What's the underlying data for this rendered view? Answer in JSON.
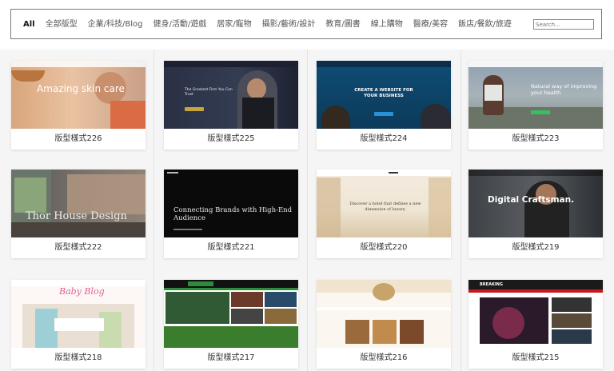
{
  "filters": [
    "All",
    "全部版型",
    "企業/科技/Blog",
    "健身/活動/遊戲",
    "居家/寵物",
    "攝影/藝術/設計",
    "教育/圖書",
    "線上購物",
    "醫療/美容",
    "飯店/餐飲/旅遊"
  ],
  "search": {
    "placeholder": "Search..."
  },
  "cards": [
    {
      "caption": "版型樣式226",
      "headline": "Amazing skin care"
    },
    {
      "caption": "版型樣式225",
      "headline": "The Greatest Firm You Can Trust"
    },
    {
      "caption": "版型樣式224",
      "headline": "CREATE A WEBSITE FOR YOUR BUSINESS"
    },
    {
      "caption": "版型樣式223",
      "headline": "Natural way of improving your health"
    },
    {
      "caption": "版型樣式222",
      "headline": "Thor House Design"
    },
    {
      "caption": "版型樣式221",
      "headline": "Connecting Brands with High-End Audience"
    },
    {
      "caption": "版型樣式220",
      "headline": "Discover a hotel that defines a new dimension of luxury."
    },
    {
      "caption": "版型樣式219",
      "headline": "Digital Craftsman."
    },
    {
      "caption": "版型樣式218",
      "headline": "Baby Blog"
    },
    {
      "caption": "版型樣式217",
      "headline": ""
    },
    {
      "caption": "版型樣式216",
      "headline": ""
    },
    {
      "caption": "版型樣式215",
      "headline": "BREAKING"
    }
  ]
}
